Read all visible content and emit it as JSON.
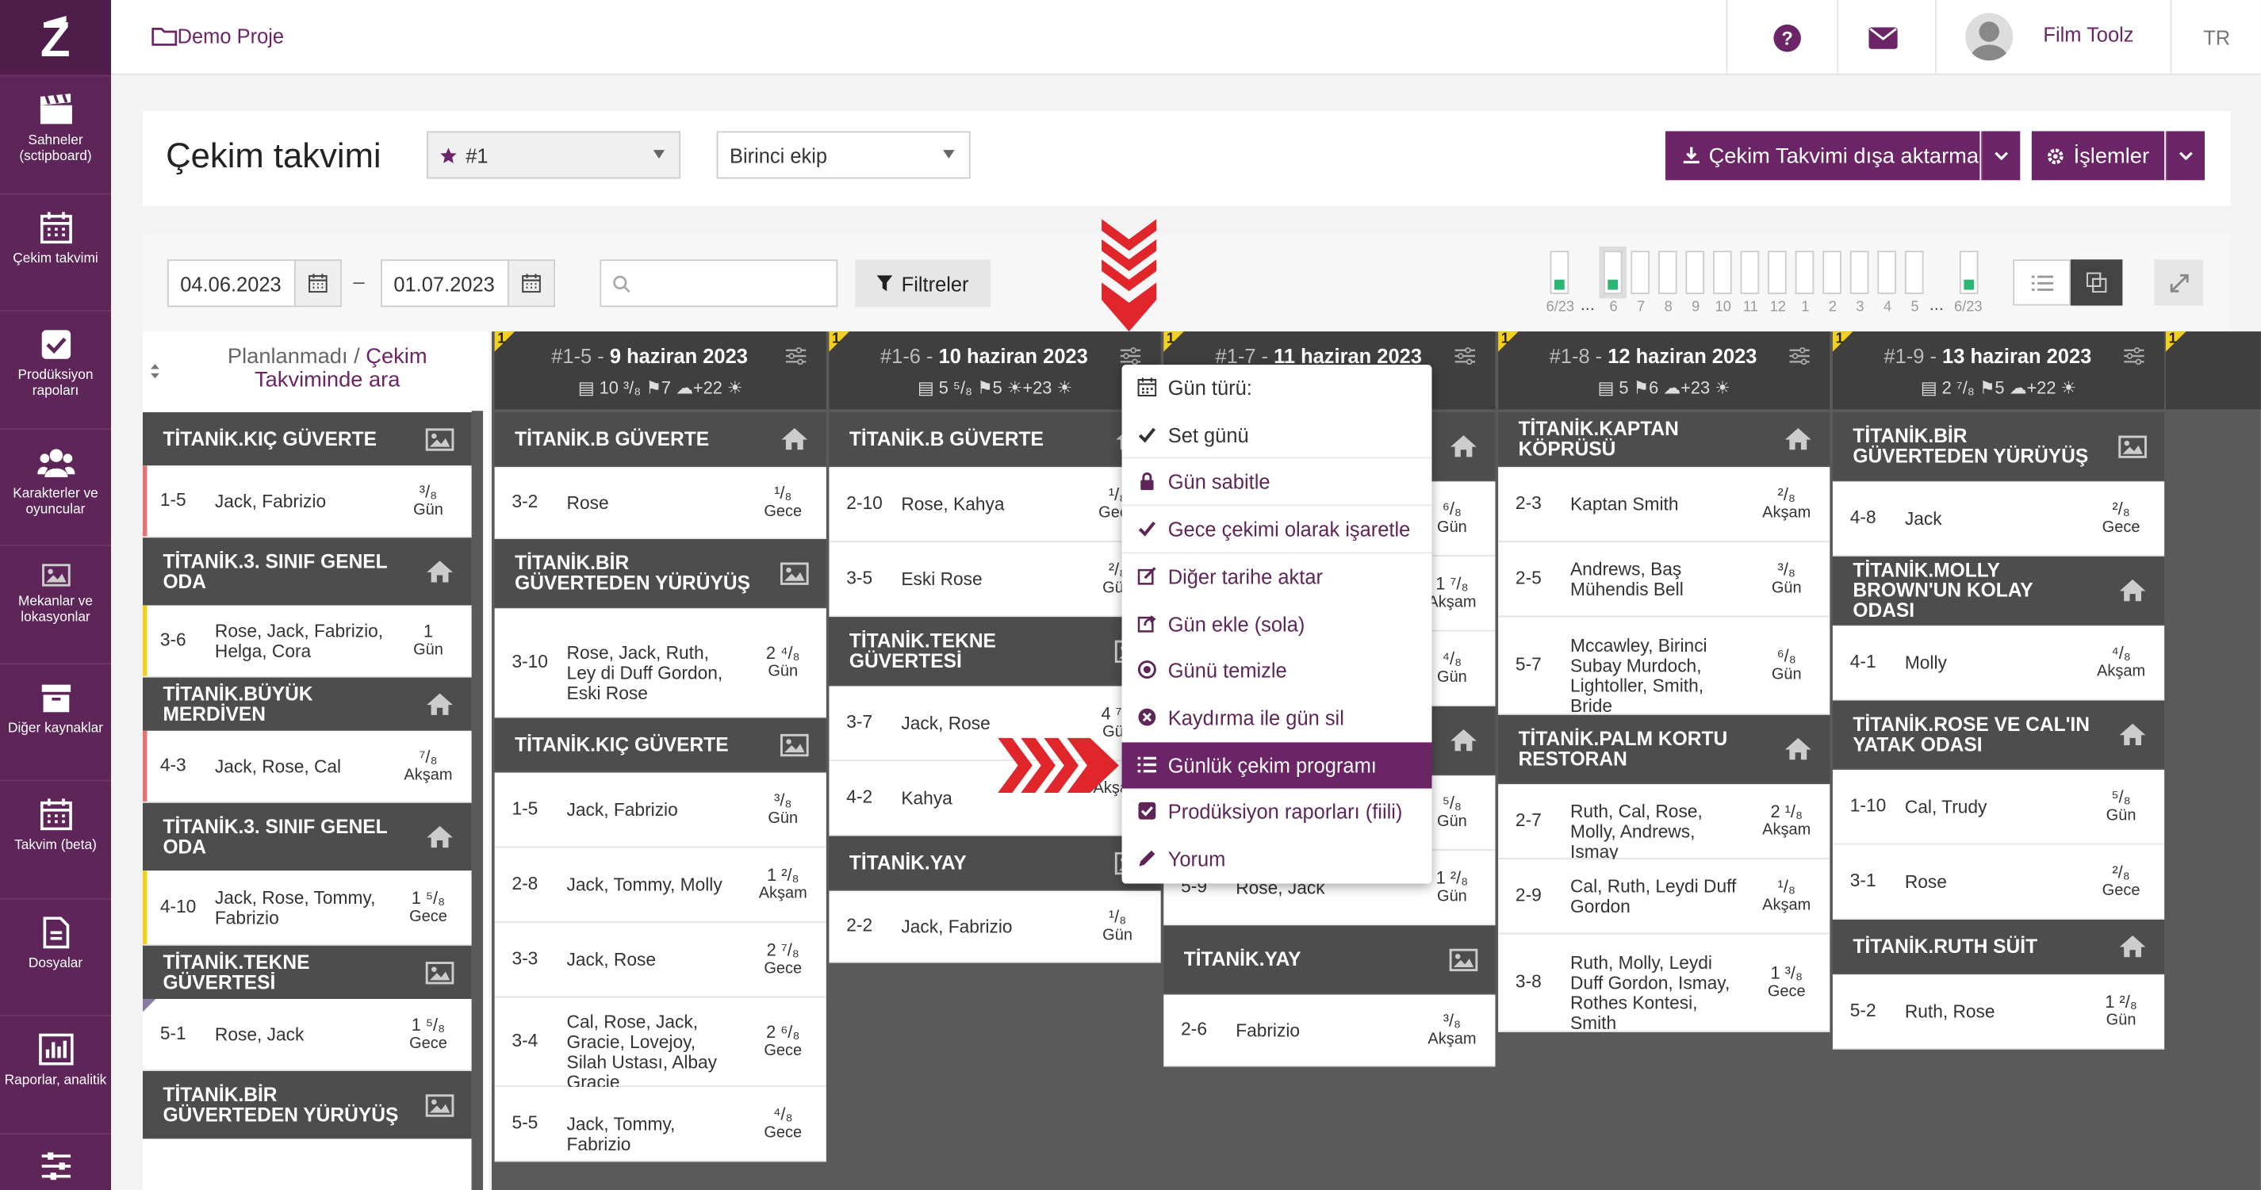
{
  "project": {
    "name": "Demo Proje"
  },
  "topbar": {
    "user": "Film Toolz",
    "lang": "TR"
  },
  "sidebar": [
    {
      "label": "Sahneler (sctipboard)",
      "icon": "clapperboard-icon"
    },
    {
      "label": "Çekim takvimi",
      "icon": "calendar-icon"
    },
    {
      "label": "Prodüksiyon rapoları",
      "icon": "checkbox-icon"
    },
    {
      "label": "Karakterler ve oyuncular",
      "icon": "users-icon"
    },
    {
      "label": "Mekanlar ve lokasyonlar",
      "icon": "image-icon"
    },
    {
      "label": "Diğer kaynaklar",
      "icon": "archive-icon"
    },
    {
      "label": "Takvim (beta)",
      "icon": "calendar-icon"
    },
    {
      "label": "Dosyalar",
      "icon": "file-icon"
    },
    {
      "label": "Raporlar, analitik",
      "icon": "chart-icon"
    },
    {
      "label": "",
      "icon": "sliders-icon"
    }
  ],
  "header": {
    "title": "Çekim takvimi",
    "schedule_select": "#1",
    "crew_select": "Birinci ekip",
    "export_button": "Çekim Takvimi dışa aktarma",
    "actions_button": "İşlemler"
  },
  "toolbar": {
    "date_from": "04.06.2023",
    "date_sep": "–",
    "date_to": "01.07.2023",
    "search_placeholder": "",
    "filters_button": "Filtreler",
    "weeks_left": "6/23",
    "weeks_right": "6/23",
    "week_labels": [
      "6",
      "7",
      "8",
      "9",
      "10",
      "11",
      "12",
      "1",
      "2",
      "3",
      "4",
      "5"
    ],
    "ellipsis": "..."
  },
  "unplanned": {
    "title_a": "Planlanmadı / ",
    "title_b": "Çekim Takviminde ara",
    "groups": [
      {
        "set": "TİTANİK.KIÇ GÜVERTE",
        "icon": "image-icon",
        "scenes": [
          {
            "n": "1-5",
            "ch": "Jack, Fabrizio",
            "d": "³/₈",
            "t": "Gün",
            "bar": "#e57373"
          }
        ]
      },
      {
        "set": "TİTANİK.3. SINIF GENEL ODA",
        "icon": "home-icon",
        "scenes": [
          {
            "n": "3-6",
            "ch": "Rose, Jack, Fabrizio, Helga, Cora",
            "d": "1",
            "t": "Gün",
            "bar": "#f2d01b"
          }
        ]
      },
      {
        "set": "TİTANİK.BÜYÜK MERDİVEN",
        "icon": "home-icon",
        "scenes": [
          {
            "n": "4-3",
            "ch": "Jack, Rose, Cal",
            "d": "⁷/₈",
            "t": "Akşam",
            "bar": "#e57373"
          }
        ]
      },
      {
        "set": "TİTANİK.3. SINIF GENEL ODA",
        "icon": "home-icon",
        "scenes": [
          {
            "n": "4-10",
            "ch": "Jack, Rose, Tommy, Fabrizio",
            "d": "1 ⁵/₈",
            "t": "Gece",
            "bar": "#f2d01b"
          }
        ]
      },
      {
        "set": "TİTANİK.TEKNE GÜVERTESİ",
        "icon": "image-icon",
        "scenes": [
          {
            "n": "5-1",
            "ch": "Rose, Jack",
            "d": "1 ⁵/₈",
            "t": "Gece",
            "bar": ""
          }
        ]
      },
      {
        "set": "TİTANİK.BİR GÜVERTEDEN YÜRÜYÜŞ",
        "icon": "image-icon",
        "scenes": []
      }
    ]
  },
  "days": [
    {
      "code": "#1-5 - ",
      "date": "9 haziran 2023",
      "flag": "1",
      "stats": "▤ 10 ³/₈  ⚑7  ☁+22  ☀",
      "groups": [
        {
          "set": "TİTANİK.B GÜVERTE",
          "icon": "home-icon",
          "scenes": [
            {
              "n": "3-2",
              "ch": "Rose",
              "d": "¹/₈",
              "t": "Gece"
            }
          ]
        },
        {
          "set": "TİTANİK.BİR GÜVERTEDEN YÜRÜYÜŞ",
          "icon": "image-icon",
          "scenes": [
            {
              "n": "3-10",
              "ch": "Rose, Jack, Ruth, Ley di Duff Gordon, Eski Rose",
              "d": "2 ⁴/₈",
              "t": "Gün"
            }
          ]
        },
        {
          "set": "TİTANİK.KIÇ GÜVERTE",
          "icon": "image-icon",
          "scenes": [
            {
              "n": "1-5",
              "ch": "Jack, Fabrizio",
              "d": "³/₈",
              "t": "Gün"
            },
            {
              "n": "2-8",
              "ch": "Jack, Tommy, Molly",
              "d": "1 ²/₈",
              "t": "Akşam"
            },
            {
              "n": "3-3",
              "ch": "Jack, Rose",
              "d": "2 ⁷/₈",
              "t": "Gece"
            },
            {
              "n": "3-4",
              "ch": "Cal, Rose, Jack, Gracie, Lovejoy, Silah Ustası, Albay Gracie",
              "d": "2 ⁶/₈",
              "t": "Gece"
            },
            {
              "n": "5-5",
              "ch": "Jack, Tommy, Fabrizio",
              "d": "⁴/₈",
              "t": "Gece"
            }
          ]
        }
      ]
    },
    {
      "code": "#1-6 - ",
      "date": "10 haziran 2023",
      "flag": "1",
      "stats": "▤ 5 ⁵/₈  ⚑5  ☀+23  ☀",
      "groups": [
        {
          "set": "TİTANİK.B GÜVERTE",
          "icon": "home-icon",
          "scenes": [
            {
              "n": "2-10",
              "ch": "Rose, Kahya",
              "d": "¹/₈",
              "t": "Gece"
            },
            {
              "n": "3-5",
              "ch": "Eski Rose",
              "d": "²/₈",
              "t": "Gün"
            }
          ]
        },
        {
          "set": "TİTANİK.TEKNE GÜVERTESİ",
          "icon": "image-icon",
          "scenes": [
            {
              "n": "3-7",
              "ch": "Jack, Rose",
              "d": "4 ⁷/₈",
              "t": "Gün"
            },
            {
              "n": "4-2",
              "ch": "Kahya",
              "d": "",
              "t": "Akşam"
            }
          ]
        },
        {
          "set": "TİTANİK.YAY",
          "icon": "image-icon",
          "scenes": [
            {
              "n": "2-2",
              "ch": "Jack, Fabrizio",
              "d": "¹/₈",
              "t": "Gün"
            }
          ]
        }
      ]
    },
    {
      "code": "#1-7 - ",
      "date": "11 haziran 2023",
      "flag": "1",
      "stats": "",
      "groups": [
        {
          "set": "",
          "icon": "home-icon",
          "scenes": [
            {
              "n": "",
              "ch": "",
              "d": "⁶/₈",
              "t": "Gün"
            },
            {
              "n": "",
              "ch": "",
              "d": "1 ⁷/₈",
              "t": "Akşam"
            },
            {
              "n": "",
              "ch": "",
              "d": "⁴/₈",
              "t": "Gün"
            }
          ]
        },
        {
          "set": "",
          "icon": "home-icon",
          "scenes": [
            {
              "n": "",
              "ch": "",
              "d": "⁵/₈",
              "t": "Gün"
            },
            {
              "n": "5-9",
              "ch": "Rose, Jack",
              "d": "1 ²/₈",
              "t": "Gün"
            }
          ]
        },
        {
          "set": "TİTANİK.YAY",
          "icon": "image-icon",
          "scenes": [
            {
              "n": "2-6",
              "ch": "Fabrizio",
              "d": "³/₈",
              "t": "Akşam"
            }
          ]
        }
      ]
    },
    {
      "code": "#1-8 - ",
      "date": "12 haziran 2023",
      "flag": "1",
      "stats": "▤ 5  ⚑6  ☁+23  ☀",
      "groups": [
        {
          "set": "TİTANİK.KAPTAN KÖPRÜSÜ",
          "icon": "home-icon",
          "scenes": [
            {
              "n": "2-3",
              "ch": "Kaptan Smith",
              "d": "²/₈",
              "t": "Akşam"
            },
            {
              "n": "2-5",
              "ch": "Andrews, Baş Mühendis Bell",
              "d": "³/₈",
              "t": "Gün"
            },
            {
              "n": "5-7",
              "ch": "Mccawley, Birinci Subay Murdoch, Lightoller, Smith, Bride",
              "d": "⁶/₈",
              "t": "Gün"
            }
          ]
        },
        {
          "set": "TİTANİK.PALM KORTU RESTORAN",
          "icon": "home-icon",
          "scenes": [
            {
              "n": "2-7",
              "ch": "Ruth, Cal, Rose, Molly, Andrews, Ismay",
              "d": "2 ¹/₈",
              "t": "Akşam"
            },
            {
              "n": "2-9",
              "ch": "Cal, Ruth, Leydi Duff Gordon",
              "d": "¹/₈",
              "t": "Akşam"
            },
            {
              "n": "3-8",
              "ch": "Ruth, Molly, Leydi Duff Gordon, Ismay, Rothes Kontesi, Smith",
              "d": "1 ³/₈",
              "t": "Gece"
            }
          ]
        }
      ]
    },
    {
      "code": "#1-9 - ",
      "date": "13 haziran 2023",
      "flag": "1",
      "stats": "▤ 2 ⁷/₈  ⚑5  ☁+22  ☀",
      "groups": [
        {
          "set": "TİTANİK.BİR GÜVERTEDEN YÜRÜYÜŞ",
          "icon": "image-icon",
          "scenes": [
            {
              "n": "4-8",
              "ch": "Jack",
              "d": "²/₈",
              "t": "Gece"
            }
          ]
        },
        {
          "set": "TİTANİK.MOLLY BROWN'UN KOLAY ODASI",
          "icon": "home-icon",
          "scenes": [
            {
              "n": "4-1",
              "ch": "Molly",
              "d": "⁴/₈",
              "t": "Akşam"
            }
          ]
        },
        {
          "set": "TİTANİK.ROSE VE CAL'IN YATAK ODASI",
          "icon": "home-icon",
          "scenes": [
            {
              "n": "1-10",
              "ch": "Cal, Trudy",
              "d": "⁵/₈",
              "t": "Gün"
            },
            {
              "n": "3-1",
              "ch": "Rose",
              "d": "²/₈",
              "t": "Gece"
            }
          ]
        },
        {
          "set": "TİTANİK.RUTH SÜİT",
          "icon": "home-icon",
          "scenes": [
            {
              "n": "5-2",
              "ch": "Ruth, Rose",
              "d": "1 ²/₈",
              "t": "Gün"
            }
          ]
        }
      ]
    }
  ],
  "context_menu": [
    {
      "label": "Gün türü:",
      "icon": "calendar-icon",
      "style": "dark"
    },
    {
      "label": "Set günü",
      "icon": "check-icon",
      "style": "dark"
    },
    {
      "label": "Gün sabitle",
      "icon": "lock-icon",
      "style": ""
    },
    {
      "label": "Gece çekimi olarak işaretle",
      "icon": "check-icon",
      "style": ""
    },
    {
      "label": "Diğer tarihe aktar",
      "icon": "edit-icon",
      "style": ""
    },
    {
      "label": "Gün ekle (sola)",
      "icon": "share-icon",
      "style": ""
    },
    {
      "label": "Günü temizle",
      "icon": "clear-icon",
      "style": ""
    },
    {
      "label": "Kaydırma ile gün sil",
      "icon": "delete-icon",
      "style": ""
    },
    {
      "label": "Günlük çekim programı",
      "icon": "list-icon",
      "style": "active"
    },
    {
      "label": "Prodüksiyon raporları (fiili)",
      "icon": "checkbox-icon",
      "style": ""
    },
    {
      "label": "Yorum",
      "icon": "pencil-icon",
      "style": ""
    }
  ],
  "colors": {
    "brand": "#6b2466",
    "sidebar": "#5e2559",
    "set_header": "#4d4d4d",
    "accent_red": "#e0262b",
    "flag": "#f2d01b"
  }
}
